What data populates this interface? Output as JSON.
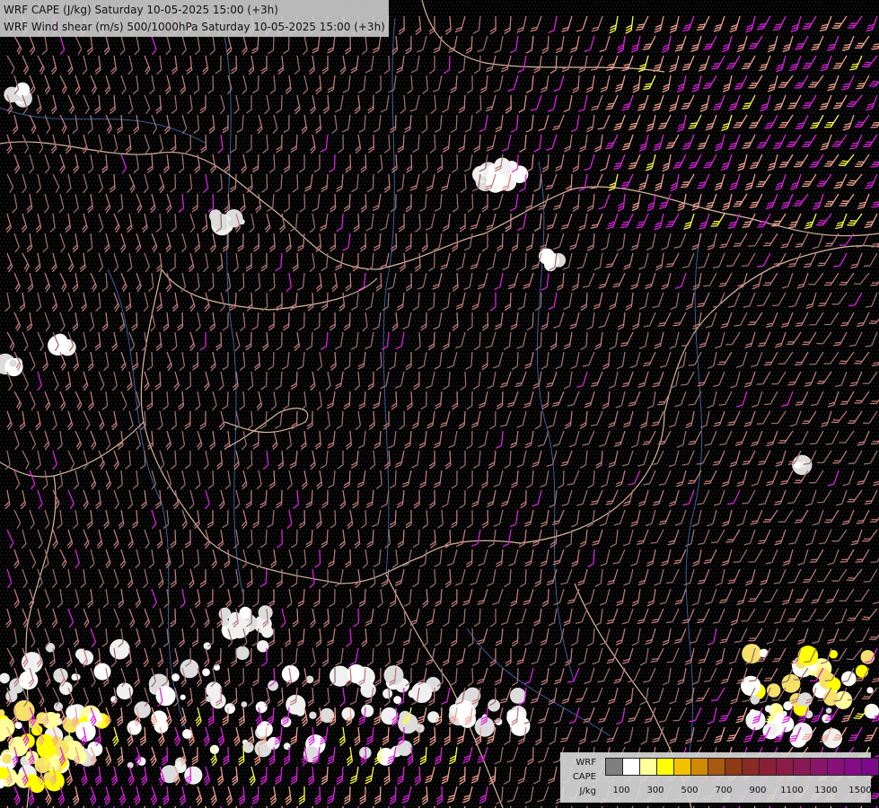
{
  "header": {
    "line1": "WRF CAPE (J/kg) Saturday 10-05-2025 15:00 (+3h)",
    "line2": "WRF Wind shear (m/s) 500/1000hPa Saturday 10-05-2025 15:00 (+3h)"
  },
  "legend": {
    "label_line1": "WRF",
    "label_line2": "CAPE",
    "unit": "J/kg",
    "tick_labels": [
      "100",
      "300",
      "500",
      "700",
      "900",
      "1100",
      "1300",
      "1500"
    ],
    "colors": [
      "#7f7f7f",
      "#ffffff",
      "#ffff9c",
      "#ffff00",
      "#f5c000",
      "#d08a00",
      "#a85a10",
      "#8e3a14",
      "#8a2a26",
      "#8a2035",
      "#8c1c45",
      "#8a1855",
      "#8c1468",
      "#88107a",
      "#860c86",
      "#7a0a8a"
    ]
  },
  "map_style": {
    "background": "#000000",
    "border_color": "#d8b8a0",
    "river_color": "#4a78c8",
    "barb_colors": [
      "#9c6e6e",
      "#c07a7a",
      "#e08a8a",
      "#f0a090",
      "#e020e0",
      "#ffff40"
    ]
  }
}
